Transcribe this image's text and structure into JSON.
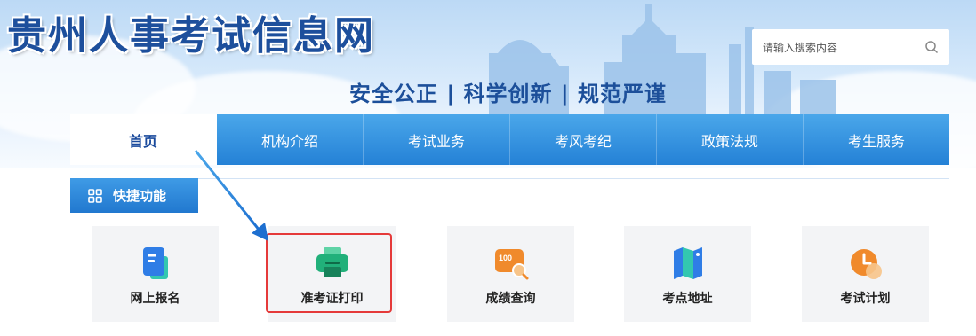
{
  "header": {
    "site_title": "贵州人事考试信息网",
    "slogan": "安全公正 | 科学创新 | 规范严谨",
    "search_placeholder": "请输入搜索内容"
  },
  "nav": {
    "items": [
      {
        "label": "首页",
        "active": true
      },
      {
        "label": "机构介绍"
      },
      {
        "label": "考试业务"
      },
      {
        "label": "考风考纪"
      },
      {
        "label": "政策法规"
      },
      {
        "label": "考生服务"
      }
    ]
  },
  "quick": {
    "title": "快捷功能",
    "items": [
      {
        "label": "网上报名",
        "icon": "form-icon",
        "color": "#2f7de6"
      },
      {
        "label": "准考证打印",
        "icon": "printer-icon",
        "color": "#21b07a",
        "highlighted": true
      },
      {
        "label": "成绩查询",
        "icon": "score-icon",
        "color": "#f08a2c"
      },
      {
        "label": "考点地址",
        "icon": "map-icon",
        "color": "#2f7de6"
      },
      {
        "label": "考试计划",
        "icon": "clock-icon",
        "color": "#f08a2c"
      }
    ]
  },
  "colors": {
    "brand_blue": "#2481d6",
    "highlight_red": "#e53a3a"
  }
}
